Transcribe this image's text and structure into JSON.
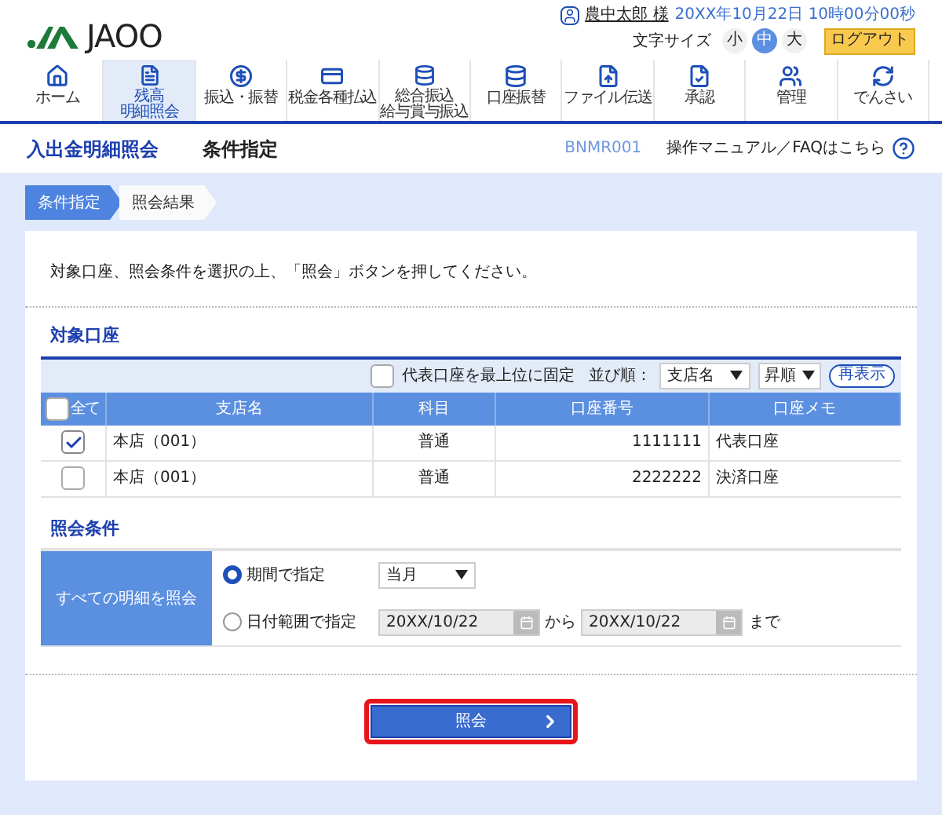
{
  "header": {
    "logo": "JAOO",
    "user_name": "農中太郎 様",
    "datetime": "20XX年10月22日 10時00分00秒",
    "font_size_label": "文字サイズ",
    "font_sizes": [
      {
        "label": "小",
        "selected": false
      },
      {
        "label": "中",
        "selected": true
      },
      {
        "label": "大",
        "selected": false
      }
    ],
    "logout": "ログアウト"
  },
  "nav": [
    {
      "kind": "home",
      "lines": [
        "ホーム"
      ],
      "selected": false
    },
    {
      "kind": "document",
      "lines": [
        "残高",
        "明細照会"
      ],
      "selected": true
    },
    {
      "kind": "yen",
      "lines": [
        "振込・振替"
      ],
      "selected": false
    },
    {
      "kind": "card",
      "lines": [
        "税金各種払込"
      ],
      "selected": false
    },
    {
      "kind": "stack",
      "lines": [
        "総合振込",
        "給与賞与振込"
      ],
      "selected": false
    },
    {
      "kind": "stack",
      "lines": [
        "口座振替"
      ],
      "selected": false
    },
    {
      "kind": "file",
      "lines": [
        "ファイル伝送"
      ],
      "selected": false
    },
    {
      "kind": "approve",
      "lines": [
        "承認"
      ],
      "selected": false
    },
    {
      "kind": "admin",
      "lines": [
        "管理"
      ],
      "selected": false
    },
    {
      "kind": "cycle",
      "lines": [
        "でんさい"
      ],
      "selected": false
    }
  ],
  "page_title": "入出金明細照会",
  "subtitle": "条件指定",
  "screen_id": "BNMR001",
  "help_link": "操作マニュアル／FAQはこちら",
  "steps": [
    {
      "label": "条件指定",
      "selected": true
    },
    {
      "label": "照会結果",
      "selected": false
    }
  ],
  "instruction": "対象口座、照会条件を選択の上、「照会」ボタンを押してください。",
  "accounts": {
    "title": "対象口座",
    "pin_label": "代表口座を最上位に固定",
    "pin_checked": false,
    "sort_label": "並び順：",
    "sort_field": "支店名",
    "sort_order": "昇順",
    "refresh": "再表示",
    "columns": [
      "全て",
      "支店名",
      "科目",
      "口座番号",
      "口座メモ"
    ],
    "all_checked": false,
    "rows": [
      {
        "checked": true,
        "branch": "本店（001）",
        "type": "普通",
        "number": "1111111",
        "memo": "代表口座"
      },
      {
        "checked": false,
        "branch": "本店（001）",
        "type": "普通",
        "number": "2222222",
        "memo": "決済口座"
      }
    ]
  },
  "conditions": {
    "title": "照会条件",
    "label": "すべての明細を照会",
    "options": [
      {
        "kind": "period",
        "label": "期間で指定",
        "selected": true,
        "value": "当月"
      },
      {
        "kind": "range",
        "label": "日付範囲で指定",
        "selected": false,
        "from": "20XX/10/22",
        "between": "から",
        "to": "20XX/10/22",
        "after": "まで"
      }
    ]
  },
  "submit": "照会"
}
